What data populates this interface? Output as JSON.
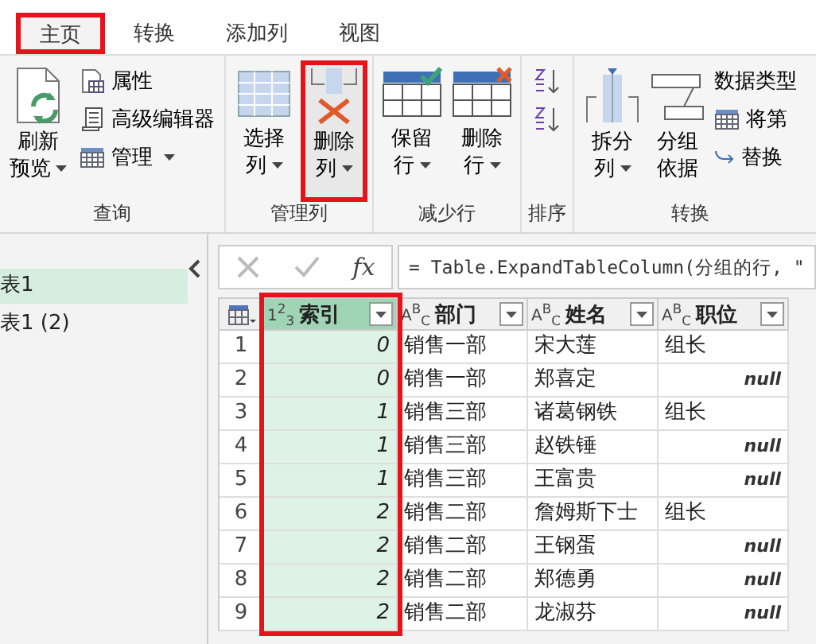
{
  "tabs": [
    {
      "label": "主页",
      "selected": true,
      "highlighted": true
    },
    {
      "label": "转换",
      "selected": false,
      "highlighted": false
    },
    {
      "label": "添加列",
      "selected": false,
      "highlighted": false
    },
    {
      "label": "视图",
      "selected": false,
      "highlighted": false
    }
  ],
  "ribbon": [
    {
      "label": "查询",
      "items": [
        {
          "kind": "large",
          "lines": [
            "刷新",
            "预览"
          ],
          "dropdown": true,
          "highlighted": false
        },
        {
          "kind": "stack",
          "entries": [
            {
              "label": "属性",
              "dropdown": false
            },
            {
              "label": "高级编辑器",
              "dropdown": false
            },
            {
              "label": "管理",
              "dropdown": true
            }
          ]
        }
      ]
    },
    {
      "label": "管理列",
      "items": [
        {
          "kind": "large",
          "lines": [
            "选择",
            "列"
          ],
          "dropdown": true,
          "highlighted": false
        },
        {
          "kind": "large",
          "lines": [
            "删除",
            "列"
          ],
          "dropdown": true,
          "highlighted": true
        }
      ]
    },
    {
      "label": "减少行",
      "items": [
        {
          "kind": "large",
          "lines": [
            "保留",
            "行"
          ],
          "dropdown": true,
          "highlighted": false
        },
        {
          "kind": "large",
          "lines": [
            "删除",
            "行"
          ],
          "dropdown": true,
          "highlighted": false
        }
      ]
    },
    {
      "label": "排序",
      "items": [
        {
          "kind": "sort"
        }
      ]
    },
    {
      "label": "转换",
      "items": [
        {
          "kind": "large",
          "lines": [
            "拆分",
            "列"
          ],
          "dropdown": true,
          "highlighted": false
        },
        {
          "kind": "large",
          "lines": [
            "分组",
            "依据"
          ],
          "dropdown": false,
          "highlighted": false
        },
        {
          "kind": "stack",
          "entries": [
            {
              "label": "数据类型",
              "dropdown": false
            },
            {
              "label": "将第",
              "dropdown": false
            },
            {
              "label": "替换",
              "dropdown": false
            }
          ]
        }
      ]
    }
  ],
  "queries": [
    {
      "label": "表1",
      "selected": true
    },
    {
      "label": "表1 (2)",
      "selected": false
    }
  ],
  "formula_bar": {
    "fx_label": "fx",
    "formula": "= Table.ExpandTableColumn(分组的行, \""
  },
  "table": {
    "columns": [
      {
        "type_label": "1$^{2}$$_{3}$",
        "name": "索引",
        "kind": "number",
        "selected": true,
        "highlighted": true
      },
      {
        "type_label": "A$^{B}$$_{C}$",
        "name": "部门",
        "kind": "text",
        "selected": false,
        "highlighted": false
      },
      {
        "type_label": "A$^{B}$$_{C}$",
        "name": "姓名",
        "kind": "text",
        "selected": false,
        "highlighted": false
      },
      {
        "type_label": "A$^{B}$$_{C}$",
        "name": "职位",
        "kind": "text",
        "selected": false,
        "highlighted": false
      }
    ],
    "rows": [
      {
        "number": "1",
        "cells": [
          "0",
          "销售一部",
          "宋大莲",
          "组长"
        ]
      },
      {
        "number": "2",
        "cells": [
          "0",
          "销售一部",
          "郑喜定",
          "null"
        ]
      },
      {
        "number": "3",
        "cells": [
          "1",
          "销售三部",
          "诸葛钢铁",
          "组长"
        ]
      },
      {
        "number": "4",
        "cells": [
          "1",
          "销售三部",
          "赵铁锤",
          "null"
        ]
      },
      {
        "number": "5",
        "cells": [
          "1",
          "销售三部",
          "王富贵",
          "null"
        ]
      },
      {
        "number": "6",
        "cells": [
          "2",
          "销售二部",
          "詹姆斯下士",
          "组长"
        ]
      },
      {
        "number": "7",
        "cells": [
          "2",
          "销售二部",
          "王钢蛋",
          "null"
        ]
      },
      {
        "number": "8",
        "cells": [
          "2",
          "销售二部",
          "郑德勇",
          "null"
        ]
      },
      {
        "number": "9",
        "cells": [
          "2",
          "销售二部",
          "龙淑芬",
          "null"
        ]
      }
    ],
    "null_cells": [
      [
        false,
        false,
        false,
        false
      ],
      [
        false,
        false,
        false,
        true
      ],
      [
        false,
        false,
        false,
        false
      ],
      [
        false,
        false,
        false,
        true
      ],
      [
        false,
        false,
        false,
        true
      ],
      [
        false,
        false,
        false,
        false
      ],
      [
        false,
        false,
        false,
        true
      ],
      [
        false,
        false,
        false,
        true
      ],
      [
        false,
        false,
        false,
        true
      ]
    ]
  }
}
